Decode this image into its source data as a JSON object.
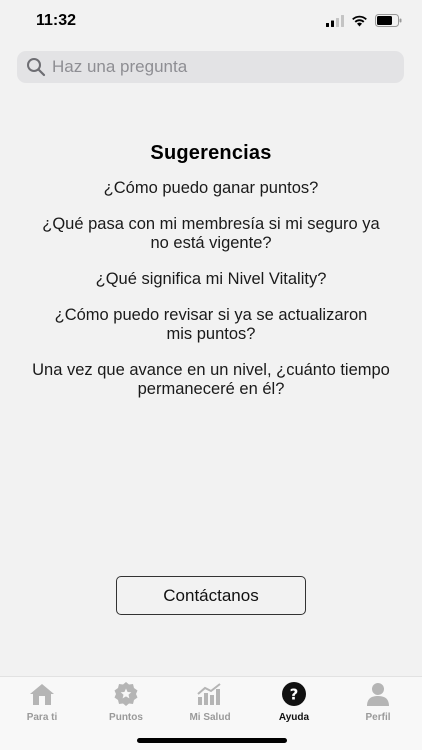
{
  "status_bar": {
    "time": "11:32"
  },
  "search": {
    "placeholder": "Haz una pregunta"
  },
  "suggestions": {
    "title": "Sugerencias",
    "items": [
      "¿Cómo puedo ganar puntos?",
      "¿Qué pasa con mi membresía si mi seguro ya no está vigente?",
      "¿Qué significa mi Nivel Vitality?",
      "¿Cómo puedo revisar si ya se actualizaron mis puntos?",
      "Una vez que avance en un nivel, ¿cuánto tiempo permaneceré en él?"
    ]
  },
  "contact": {
    "label": "Contáctanos"
  },
  "tabs": [
    {
      "label": "Para ti",
      "icon": "home-icon",
      "active": false
    },
    {
      "label": "Puntos",
      "icon": "points-badge-icon",
      "active": false
    },
    {
      "label": "Mi Salud",
      "icon": "health-chart-icon",
      "active": false
    },
    {
      "label": "Ayuda",
      "icon": "help-icon",
      "active": true
    },
    {
      "label": "Perfil",
      "icon": "profile-icon",
      "active": false
    }
  ],
  "colors": {
    "background": "#f2f2f2",
    "tab_active": "#111111",
    "tab_inactive": "#9a9a9a"
  }
}
